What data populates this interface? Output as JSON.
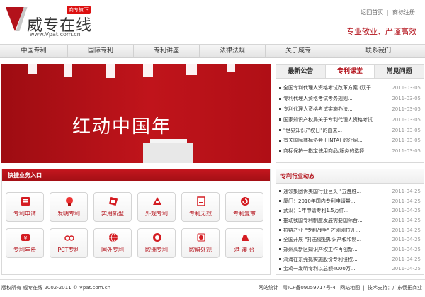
{
  "header": {
    "badge": "商专旗下",
    "brand": "威专在线",
    "url": "www.Vpat.com.cn",
    "links": [
      "返回首页",
      "商标注册"
    ],
    "slogan": "专业敬业、严谨高效"
  },
  "nav": [
    "中国专利",
    "国际专利",
    "专利讲座",
    "法律法规",
    "关于威专",
    "联系我们"
  ],
  "banner": {
    "title": "红动中国年"
  },
  "news": {
    "tabs": [
      "最新公告",
      "专利课堂",
      "常见问题"
    ],
    "active_tab": 1,
    "items": [
      {
        "title": "全国专利代理人资格考试改革方案 (双于...",
        "date": "2011-03-05"
      },
      {
        "title": "专利代理人资格考试考务规则...",
        "date": "2011-03-05"
      },
      {
        "title": "专利代理人资格考试实施办法...",
        "date": "2011-03-05"
      },
      {
        "title": "国家知识产权局关于专利代理人资格考试...",
        "date": "2011-03-05"
      },
      {
        "title": "\"世界知识产权日\"的由来...",
        "date": "2011-03-05"
      },
      {
        "title": "有关国际商标协会 ( INTA) 的介绍...",
        "date": "2011-03-05"
      },
      {
        "title": "商标保护一指定使用商品/服务的选择...",
        "date": "2011-03-05"
      }
    ]
  },
  "quick": {
    "title": "快捷业务入口",
    "items": [
      {
        "label": "专利申请",
        "icon": "form-icon"
      },
      {
        "label": "发明专利",
        "icon": "bulb-icon"
      },
      {
        "label": "实用新型",
        "icon": "tools-icon"
      },
      {
        "label": "外观专利",
        "icon": "design-icon"
      },
      {
        "label": "专利无效",
        "icon": "document-icon"
      },
      {
        "label": "专利复审",
        "icon": "refresh-icon"
      },
      {
        "label": "专利年费",
        "icon": "coin-icon"
      },
      {
        "label": "PCT专利",
        "icon": "glasses-icon"
      },
      {
        "label": "国外专利",
        "icon": "globe-icon"
      },
      {
        "label": "欧洲专利",
        "icon": "euro-icon"
      },
      {
        "label": "欧盟外观",
        "icon": "eu-icon"
      },
      {
        "label": "港 澳 台",
        "icon": "map-icon"
      }
    ]
  },
  "industry": {
    "title": "专利行业动态",
    "items": [
      {
        "title": "通领集团诉美国行业巨头 \"五连胜...",
        "date": "2011-04-25"
      },
      {
        "title": "厦门：2010年国内专利申请量...",
        "date": "2011-04-25"
      },
      {
        "title": "武汉：1年申请专利1.5万件...",
        "date": "2011-04-25"
      },
      {
        "title": "推动我国专利制度发展需要国际合...",
        "date": "2011-04-25"
      },
      {
        "title": "拉链产业 \"专利战争\" 才刚刚拉开...",
        "date": "2011-04-25"
      },
      {
        "title": "全国开展 \"打击侵犯知识产权和制...",
        "date": "2011-04-25"
      },
      {
        "title": "郑州高新区知识产权工作再创新...",
        "date": "2011-04-25"
      },
      {
        "title": "鸿海在东莞拟实施股份专利侵权...",
        "date": "2011-04-25"
      },
      {
        "title": "宝鸡一发明专利以总额4000万...",
        "date": "2011-04-25"
      }
    ]
  },
  "footer": {
    "left": "版权所有  威专在线  2002-2011 © Vpat.com.cn",
    "right": [
      "网站统计",
      "粤ICP备09059717号-4",
      "网站地图",
      "技术支持：广东畅拓商业"
    ]
  },
  "colors": {
    "brand_red": "#b3121b",
    "banner_red": "#c0141b"
  }
}
